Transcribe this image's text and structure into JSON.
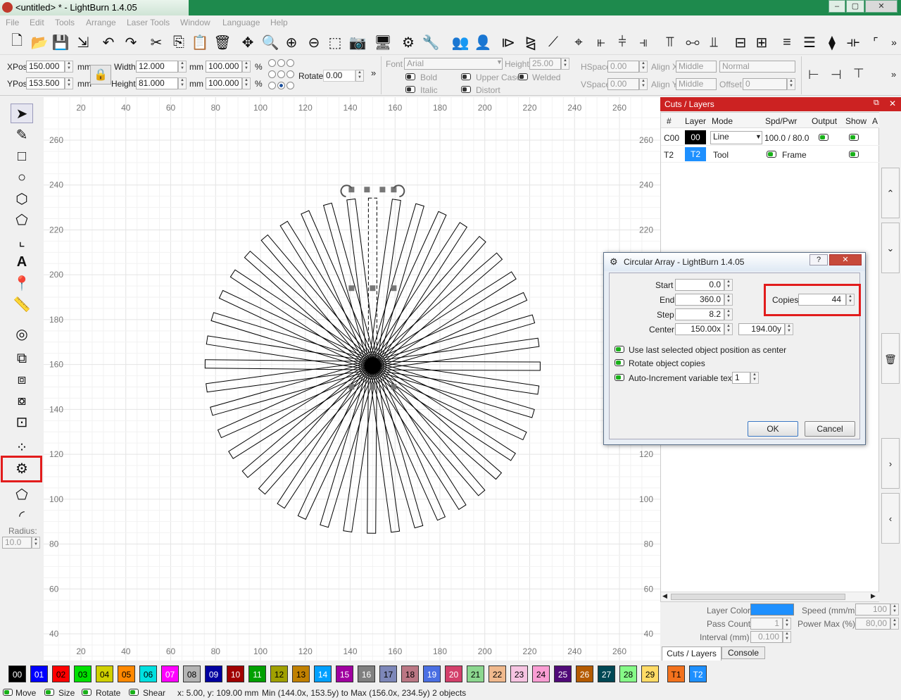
{
  "window": {
    "title": "<untitled> * - LightBurn 1.4.05",
    "min": "–",
    "max": "▢",
    "close": "✕"
  },
  "menu": [
    "File",
    "Edit",
    "Tools",
    "Arrange",
    "Laser Tools",
    "Window",
    "Language",
    "Help"
  ],
  "props": {
    "xpos_label": "XPos",
    "xpos": "150.000",
    "ypos_label": "YPos",
    "ypos": "153.500",
    "mm": "mm",
    "width_label": "Width",
    "width": "12.000",
    "height_label": "Height",
    "height": "81.000",
    "pct_w": "100.000",
    "pct_h": "100.000",
    "pct": "%",
    "rotate_label": "Rotate",
    "rotate": "0.00",
    "font_label": "Font",
    "font": "Arial",
    "fheight_label": "Height",
    "fheight": "25.00",
    "bold": "Bold",
    "italic": "Italic",
    "upper": "Upper Case",
    "welded": "Welded",
    "distort": "Distort",
    "hspace_label": "HSpace",
    "hspace": "0.00",
    "vspace_label": "VSpace",
    "vspace": "0.00",
    "alignx_label": "Align X",
    "alignx": "Middle",
    "aligny_label": "Align Y",
    "aligny": "Middle",
    "normal": "Normal",
    "offset_label": "Offset",
    "offset": "0"
  },
  "left": {
    "radius_label": "Radius:",
    "radius": "10.0"
  },
  "ruler": {
    "x": [
      "20",
      "40",
      "60",
      "80",
      "100",
      "120",
      "140",
      "160",
      "180",
      "200",
      "220",
      "240",
      "260"
    ],
    "y": [
      "260",
      "240",
      "220",
      "200",
      "180",
      "160",
      "140",
      "120",
      "100",
      "80",
      "60",
      "40"
    ]
  },
  "cuts": {
    "title": "Cuts / Layers",
    "headers": [
      "#",
      "Layer",
      "Mode",
      "Spd/Pwr",
      "Output",
      "Show",
      "A"
    ],
    "rows": [
      {
        "id": "C00",
        "layer": "00",
        "mode": "Line",
        "spdpwr": "100.0 / 80.0"
      },
      {
        "id": "T2",
        "layer": "T2",
        "mode": "Tool",
        "spdpwr": "Frame"
      }
    ],
    "layer_color": "Layer Color",
    "speed_label": "Speed (mm/m)",
    "speed": "100",
    "pass_label": "Pass Count",
    "pass": "1",
    "power_label": "Power Max (%)",
    "power": "80,00",
    "interval_label": "Interval (mm)",
    "interval": "0.100",
    "tab1": "Cuts / Layers",
    "tab2": "Console"
  },
  "dialog": {
    "title": "Circular Array - LightBurn 1.4.05",
    "start_label": "Start",
    "start": "0.0",
    "end_label": "End",
    "end": "360.0",
    "step_label": "Step",
    "step": "8.2",
    "center_label": "Center",
    "cx": "150.00x",
    "cy": "194.00y",
    "copies_label": "Copies",
    "copies": "44",
    "opt1": "Use last selected object position as center",
    "opt2": "Rotate object copies",
    "opt3": "Auto-Increment variable text",
    "opt3_val": "1",
    "ok": "OK",
    "cancel": "Cancel",
    "help": "?",
    "close": "✕"
  },
  "palette": [
    {
      "label": "00",
      "color": "#000000",
      "fg": "#ffffff"
    },
    {
      "label": "01",
      "color": "#0000ff",
      "fg": "#ffffff"
    },
    {
      "label": "02",
      "color": "#ff0000",
      "fg": "#000000"
    },
    {
      "label": "03",
      "color": "#00e000",
      "fg": "#000000"
    },
    {
      "label": "04",
      "color": "#d0d000",
      "fg": "#000000"
    },
    {
      "label": "05",
      "color": "#ff8800",
      "fg": "#000000"
    },
    {
      "label": "06",
      "color": "#00e0e0",
      "fg": "#000000"
    },
    {
      "label": "07",
      "color": "#ff00ff",
      "fg": "#ffffff"
    },
    {
      "label": "08",
      "color": "#b4b4b4",
      "fg": "#000000"
    },
    {
      "label": "09",
      "color": "#0000a0",
      "fg": "#ffffff"
    },
    {
      "label": "10",
      "color": "#a00000",
      "fg": "#ffffff"
    },
    {
      "label": "11",
      "color": "#00a000",
      "fg": "#ffffff"
    },
    {
      "label": "12",
      "color": "#a0a000",
      "fg": "#000000"
    },
    {
      "label": "13",
      "color": "#c08000",
      "fg": "#000000"
    },
    {
      "label": "14",
      "color": "#00a0ff",
      "fg": "#ffffff"
    },
    {
      "label": "15",
      "color": "#a000a0",
      "fg": "#ffffff"
    },
    {
      "label": "16",
      "color": "#808080",
      "fg": "#ffffff"
    },
    {
      "label": "17",
      "color": "#7d87b9",
      "fg": "#000000"
    },
    {
      "label": "18",
      "color": "#bb7784",
      "fg": "#000000"
    },
    {
      "label": "19",
      "color": "#4a6fe3",
      "fg": "#ffffff"
    },
    {
      "label": "20",
      "color": "#d33f6a",
      "fg": "#ffffff"
    },
    {
      "label": "21",
      "color": "#8cd78f",
      "fg": "#000000"
    },
    {
      "label": "22",
      "color": "#f0b98d",
      "fg": "#000000"
    },
    {
      "label": "23",
      "color": "#f6c4e1",
      "fg": "#000000"
    },
    {
      "label": "24",
      "color": "#fa9ed4",
      "fg": "#000000"
    },
    {
      "label": "25",
      "color": "#500a78",
      "fg": "#ffffff"
    },
    {
      "label": "26",
      "color": "#b45a00",
      "fg": "#ffffff"
    },
    {
      "label": "27",
      "color": "#004754",
      "fg": "#ffffff"
    },
    {
      "label": "28",
      "color": "#86fa88",
      "fg": "#000000"
    },
    {
      "label": "29",
      "color": "#ffdb66",
      "fg": "#000000"
    },
    {
      "label": "T1",
      "color": "#f3721d",
      "fg": "#000000"
    },
    {
      "label": "T2",
      "color": "#1e90ff",
      "fg": "#ffffff"
    }
  ],
  "status": {
    "move": "Move",
    "size": "Size",
    "rotate": "Rotate",
    "shear": "Shear",
    "coords": "x: 5.00, y: 109.00 mm",
    "range": "Min (144.0x, 153.5y) to Max (156.0x, 234.5y)  2 objects"
  },
  "icons": {
    "arrow": "pointer-icon"
  }
}
